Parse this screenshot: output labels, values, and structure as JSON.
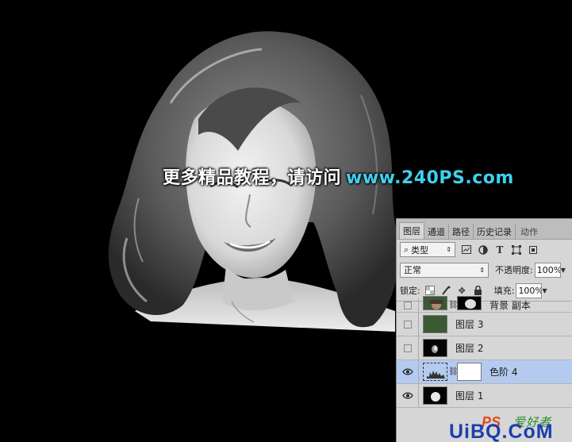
{
  "canvas": {
    "watermark_cn": "更多精品教程，请访问",
    "watermark_url": "www.240PS.com"
  },
  "layers_panel": {
    "tabs": [
      "图层",
      "通道",
      "路径",
      "历史记录",
      "动作"
    ],
    "active_tab": "图层",
    "filter": {
      "kind_label": "类型",
      "icons": [
        "image-filter-icon",
        "adjustment-filter-icon",
        "type-filter-icon",
        "shape-filter-icon",
        "smart-object-filter-icon"
      ]
    },
    "blend_mode": "正常",
    "opacity_label": "不透明度:",
    "opacity_value": "100%",
    "lock_label": "锁定:",
    "fill_label": "填充:",
    "fill_value": "100%",
    "layers": [
      {
        "name": "背景 副本",
        "visible": false,
        "selected": false,
        "thumb": "photo",
        "mask": true
      },
      {
        "name": "图层 3",
        "visible": false,
        "selected": false,
        "thumb": "green"
      },
      {
        "name": "图层 2",
        "visible": false,
        "selected": false,
        "thumb": "black"
      },
      {
        "name": "色阶 4",
        "visible": true,
        "selected": true,
        "thumb": "levels",
        "mask": true
      },
      {
        "name": "图层 1",
        "visible": true,
        "selected": false,
        "thumb": "black-face"
      }
    ],
    "thumb_colors": {
      "green": "#3b5a33",
      "selection": "#b4cbef",
      "panel_bg": "#d6d6d6"
    }
  },
  "site_logo": {
    "ps_text": "PS",
    "cn_text": "爱好者",
    "domain": "UiBQ.CoM"
  }
}
